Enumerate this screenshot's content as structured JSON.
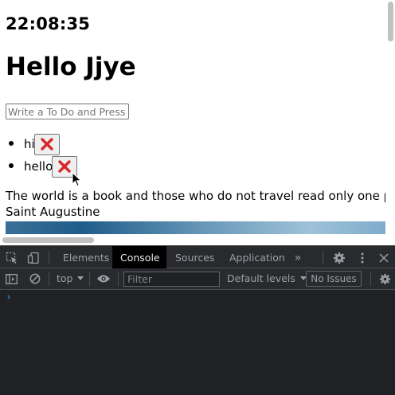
{
  "page": {
    "clock": "22:08:35",
    "greeting": "Hello Jjye",
    "todo_input": {
      "placeholder": "Write a To Do and Press",
      "value": ""
    },
    "todos": [
      {
        "text": "hi",
        "delete_icon": "red-x-icon"
      },
      {
        "text": "hello",
        "delete_icon": "red-x-icon"
      }
    ],
    "quote": {
      "text": "The world is a book and those who do not travel read only one page.",
      "author": "Saint Augustine"
    },
    "delete_color": "#d9262b"
  },
  "devtools": {
    "tabs": [
      "Elements",
      "Console",
      "Sources",
      "Application"
    ],
    "active_tab": "Console",
    "more_tabs_icon": "chevron-double-right-icon",
    "context": "top",
    "filter_placeholder": "Filter",
    "levels": "Default levels",
    "issues": "No Issues",
    "prompt": "›",
    "background": "#202124",
    "accent": "#3f8de6"
  }
}
